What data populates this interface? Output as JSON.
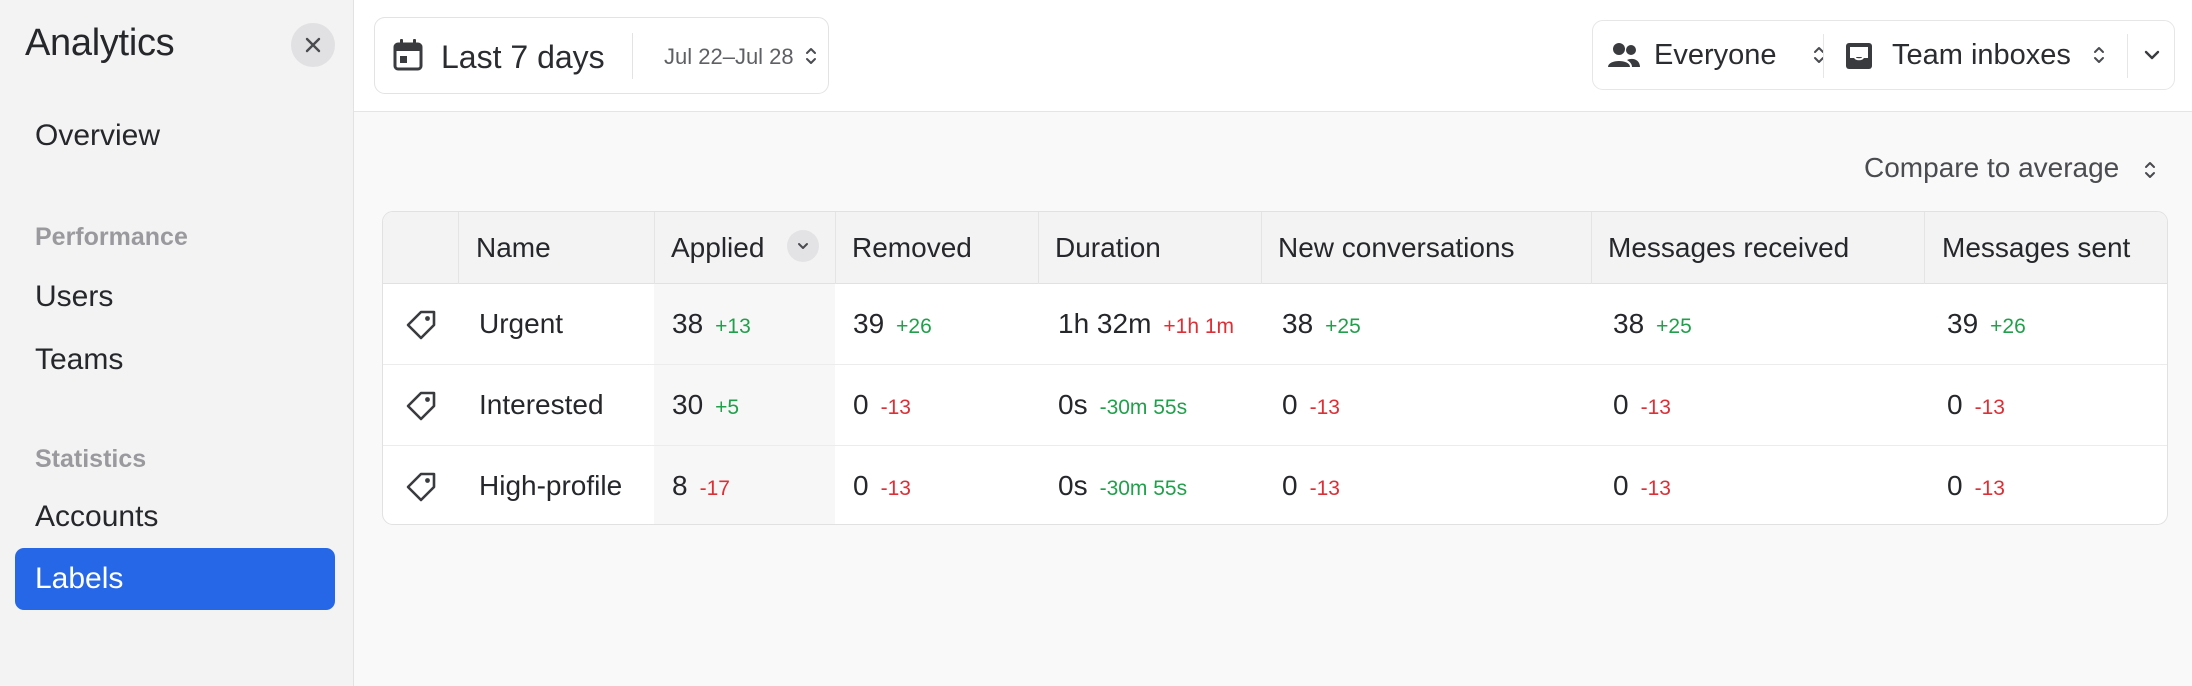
{
  "sidebar": {
    "title": "Analytics",
    "overview": "Overview",
    "performance_heading": "Performance",
    "users": "Users",
    "teams": "Teams",
    "statistics_heading": "Statistics",
    "accounts": "Accounts",
    "labels": "Labels"
  },
  "toolbar": {
    "date_label": "Last 7 days",
    "date_range": "Jul 22–Jul 28",
    "people_filter": "Everyone",
    "inbox_filter": "Team inboxes"
  },
  "compare": {
    "label": "Compare to average"
  },
  "table": {
    "columns": [
      "Name",
      "Applied",
      "Removed",
      "Duration",
      "New conversations",
      "Messages received",
      "Messages sent"
    ],
    "rows": [
      {
        "name": "Urgent",
        "applied": {
          "value": "38",
          "delta": "+13",
          "trend": "pos"
        },
        "removed": {
          "value": "39",
          "delta": "+26",
          "trend": "pos"
        },
        "duration": {
          "value": "1h 32m",
          "delta": "+1h 1m",
          "trend": "neg"
        },
        "new_conversations": {
          "value": "38",
          "delta": "+25",
          "trend": "pos"
        },
        "messages_received": {
          "value": "38",
          "delta": "+25",
          "trend": "pos"
        },
        "messages_sent": {
          "value": "39",
          "delta": "+26",
          "trend": "pos"
        }
      },
      {
        "name": "Interested",
        "applied": {
          "value": "30",
          "delta": "+5",
          "trend": "pos"
        },
        "removed": {
          "value": "0",
          "delta": "-13",
          "trend": "neg"
        },
        "duration": {
          "value": "0s",
          "delta": "-30m 55s",
          "trend": "pos"
        },
        "new_conversations": {
          "value": "0",
          "delta": "-13",
          "trend": "neg"
        },
        "messages_received": {
          "value": "0",
          "delta": "-13",
          "trend": "neg"
        },
        "messages_sent": {
          "value": "0",
          "delta": "-13",
          "trend": "neg"
        }
      },
      {
        "name": "High-profile",
        "applied": {
          "value": "8",
          "delta": "-17",
          "trend": "neg"
        },
        "removed": {
          "value": "0",
          "delta": "-13",
          "trend": "neg"
        },
        "duration": {
          "value": "0s",
          "delta": "-30m 55s",
          "trend": "pos"
        },
        "new_conversations": {
          "value": "0",
          "delta": "-13",
          "trend": "neg"
        },
        "messages_received": {
          "value": "0",
          "delta": "-13",
          "trend": "neg"
        },
        "messages_sent": {
          "value": "0",
          "delta": "-13",
          "trend": "neg"
        }
      }
    ]
  },
  "icons": {
    "close": "close-icon",
    "calendar": "calendar-icon",
    "people": "people-icon",
    "inbox": "inbox-icon",
    "chevron": "chevron-down-icon",
    "updown": "chevron-updown-icon",
    "tag": "tag-icon"
  },
  "colors": {
    "accent": "#2667e8",
    "positive": "#21a04b",
    "negative": "#dd2f35"
  }
}
